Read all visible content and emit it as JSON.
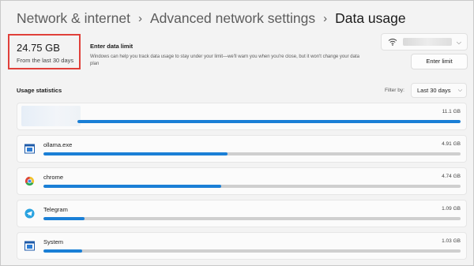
{
  "breadcrumb": {
    "items": [
      "Network & internet",
      "Advanced network settings",
      "Data usage"
    ]
  },
  "summary": {
    "total": "24.75 GB",
    "period": "From the last 30 days"
  },
  "data_limit": {
    "title": "Enter data limit",
    "description": "Windows can help you track data usage to stay under your limit—we'll warn you when you're close, but it won't change your data plan",
    "button_label": "Enter limit"
  },
  "network_selector": {
    "icon": "wifi-icon"
  },
  "usage": {
    "heading": "Usage statistics",
    "filter_label": "Filter by:",
    "filter_value": "Last 30 days",
    "apps": [
      {
        "name": "",
        "size": "11.1 GB",
        "fraction": 1.0,
        "icon": "blurred-app-icon"
      },
      {
        "name": "ollama.exe",
        "size": "4.91 GB",
        "fraction": 0.442,
        "icon": "app-window-icon"
      },
      {
        "name": "chrome",
        "size": "4.74 GB",
        "fraction": 0.427,
        "icon": "chrome-icon"
      },
      {
        "name": "Telegram",
        "size": "1.09 GB",
        "fraction": 0.098,
        "icon": "telegram-icon"
      },
      {
        "name": "System",
        "size": "1.03 GB",
        "fraction": 0.093,
        "icon": "app-window-icon"
      }
    ]
  },
  "colors": {
    "accent": "#1a7fd6",
    "highlight_border": "#e0403a",
    "track": "#cfcfcf"
  }
}
